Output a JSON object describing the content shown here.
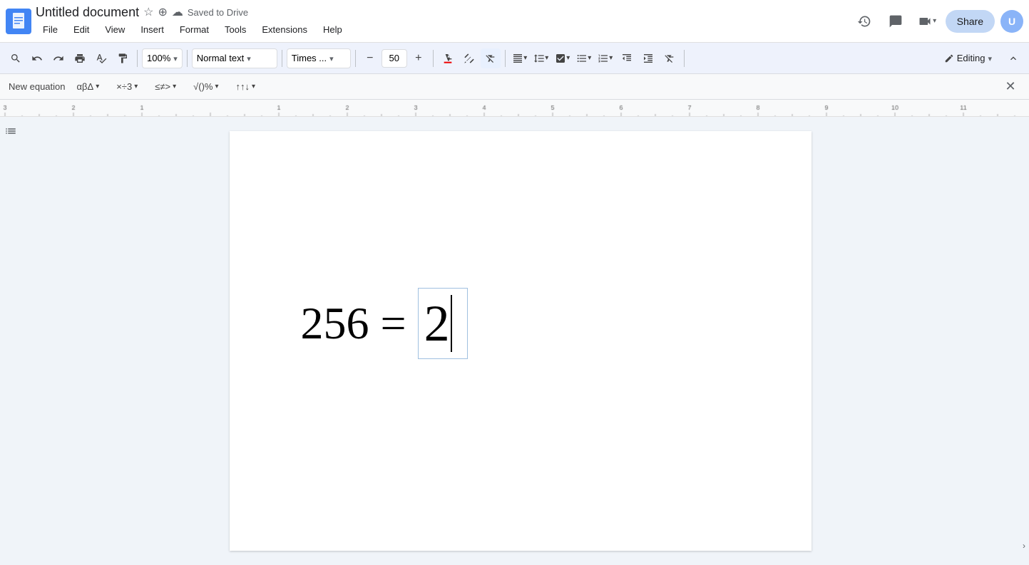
{
  "window": {
    "title": "Untitled document"
  },
  "title_bar": {
    "doc_title": "Untitled document",
    "saved_text": "Saved to Drive",
    "share_label": "Share"
  },
  "menu": {
    "items": [
      "File",
      "Edit",
      "View",
      "Insert",
      "Format",
      "Tools",
      "Extensions",
      "Help"
    ]
  },
  "toolbar": {
    "zoom": "100%",
    "style_label": "Normal text",
    "font_label": "Times ...",
    "font_size": "50",
    "editing_mode": "Editing"
  },
  "eq_toolbar": {
    "new_eq_label": "New equation",
    "greek_label": "αβΔ ▾",
    "ops_label": "×÷3 ▾",
    "rel_label": "≤≠> ▾",
    "misc_label": "√()% ▾",
    "arrows_label": "↑↑↓ ▾"
  },
  "document": {
    "equation_left": "256 =",
    "equation_right": "2"
  }
}
